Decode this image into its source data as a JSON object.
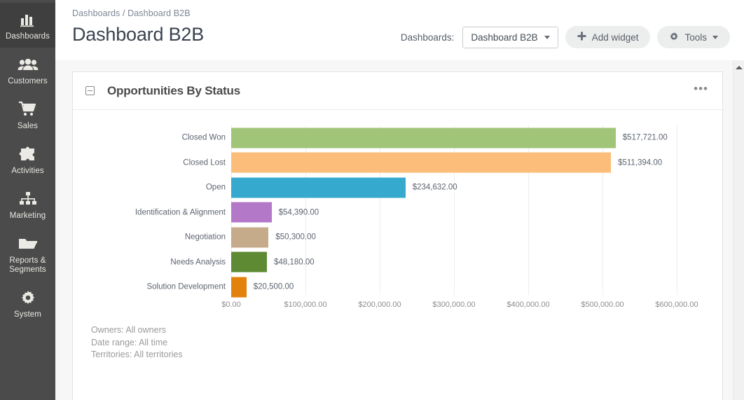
{
  "sidebar": {
    "items": [
      {
        "label": "Dashboards",
        "icon": "bar-chart-icon",
        "active": true
      },
      {
        "label": "Customers",
        "icon": "people-icon",
        "active": false
      },
      {
        "label": "Sales",
        "icon": "shopping-cart-icon",
        "active": false
      },
      {
        "label": "Activities",
        "icon": "puzzle-piece-icon",
        "active": false
      },
      {
        "label": "Marketing",
        "icon": "sitemap-icon",
        "active": false
      },
      {
        "label": "Reports & Segments",
        "icon": "folder-icon",
        "active": false
      },
      {
        "label": "System",
        "icon": "gear-icon",
        "active": false
      }
    ]
  },
  "header": {
    "breadcrumb": "Dashboards / Dashboard B2B",
    "title": "Dashboard B2B",
    "dashboards_label": "Dashboards:",
    "dashboard_select_value": "Dashboard B2B",
    "add_widget_label": "Add widget",
    "tools_label": "Tools"
  },
  "widget": {
    "title": "Opportunities By Status",
    "menu_glyph": "•••",
    "footer": {
      "owners": "Owners: All owners",
      "date_range": "Date range: All time",
      "territories": "Territories: All territories"
    }
  },
  "chart_data": {
    "type": "bar",
    "orientation": "horizontal",
    "title": "Opportunities By Status",
    "xlabel": "",
    "ylabel": "",
    "xlim": [
      0,
      600000
    ],
    "grid": true,
    "legend": "none",
    "xticks": [
      0,
      100000,
      200000,
      300000,
      400000,
      500000,
      600000
    ],
    "xtick_labels": [
      "$0.00",
      "$100,000.00",
      "$200,000.00",
      "$300,000.00",
      "$400,000.00",
      "$500,000.00",
      "$600,000.00"
    ],
    "categories": [
      "Closed Won",
      "Closed Lost",
      "Open",
      "Identification & Alignment",
      "Negotiation",
      "Needs Analysis",
      "Solution Development"
    ],
    "values": [
      517721,
      511394,
      234632,
      54390,
      50300,
      48180,
      20500
    ],
    "value_labels": [
      "$517,721.00",
      "$511,394.00",
      "$234,632.00",
      "$54,390.00",
      "$50,300.00",
      "$48,180.00",
      "$20,500.00"
    ],
    "colors": [
      "#a0c478",
      "#fbbd79",
      "#36a9ce",
      "#b378c8",
      "#c5ab89",
      "#5d8a33",
      "#e2820b"
    ]
  }
}
